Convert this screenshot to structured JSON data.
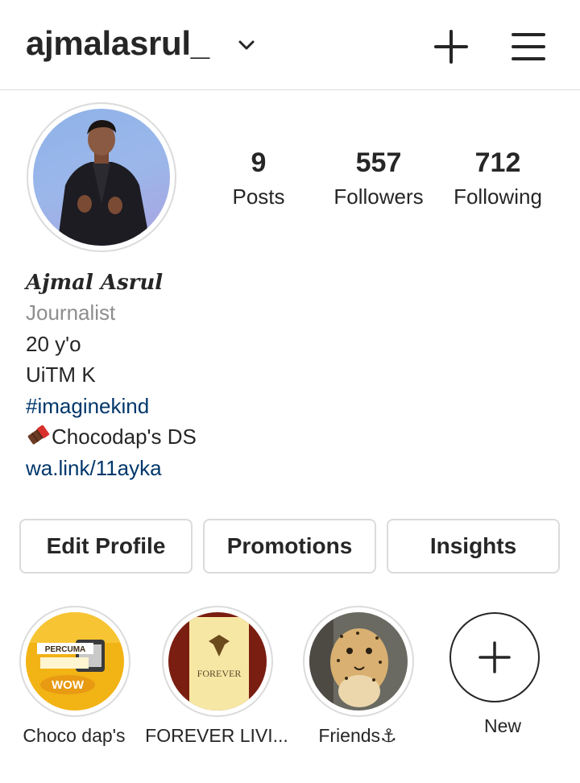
{
  "header": {
    "username": "ajmalasrul_",
    "icons": [
      "chevron-down-icon",
      "plus-icon",
      "hamburger-menu-icon"
    ]
  },
  "stats": [
    {
      "value": "9",
      "label": "Posts"
    },
    {
      "value": "557",
      "label": "Followers"
    },
    {
      "value": "712",
      "label": "Following"
    }
  ],
  "bio": {
    "display_name": "Ajmal Asrul",
    "category": "Journalist",
    "lines": [
      "20  y'o",
      "UiTM K"
    ],
    "hashtag": "#imaginekind",
    "chocolate_line": "Chocodap's DS",
    "link": "wa.link/11ayka"
  },
  "buttons": {
    "edit_profile": "Edit Profile",
    "promotions": "Promotions",
    "insights": "Insights"
  },
  "highlights": [
    {
      "label": "Choco dap's",
      "image_text": [
        "PERCUMA",
        "WOW"
      ]
    },
    {
      "label": "FOREVER LIVI...",
      "image_text": [
        "FOREVER"
      ]
    },
    {
      "label": "Friends⚓"
    },
    {
      "label": "New"
    }
  ],
  "colors": {
    "text": "#262626",
    "secondary": "#8e8e8e",
    "link": "#00376b",
    "border": "#dbdbdb"
  }
}
